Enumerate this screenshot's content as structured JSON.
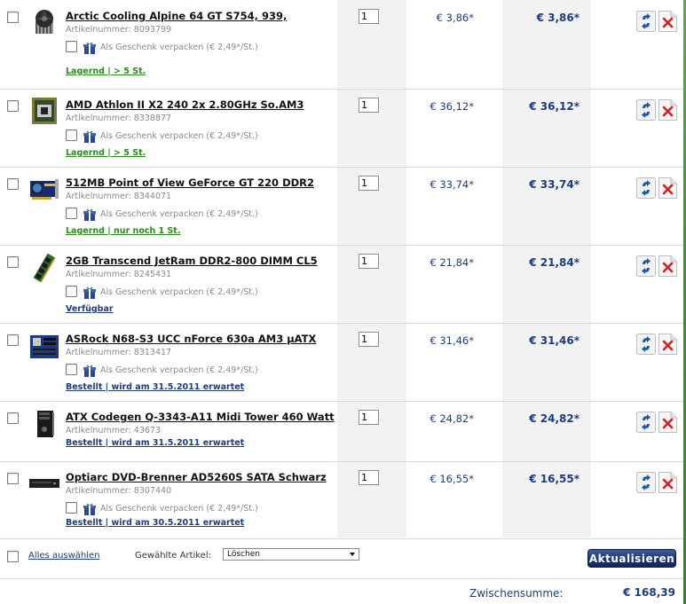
{
  "items": [
    {
      "title": "Arctic Cooling Alpine 64 GT S754, 939,",
      "artnr": "Artikelnummer: 8093799",
      "gift": "Als Geschenk verpacken (€ 2,49*/St.)",
      "status": "Lagernd | > 5 St.",
      "status_color": "#2a8a1c",
      "qty": "1",
      "price": "€ 3,86*",
      "total": "€ 3,86*",
      "thumb": "cpu-cooler-icon"
    },
    {
      "title": "AMD Athlon II X2 240 2x 2.80GHz So.AM3",
      "artnr": "Artikelnummer: 8338877",
      "gift": "Als Geschenk verpacken (€ 2,49*/St.)",
      "status": "Lagernd | > 5 St.",
      "status_color": "#2a8a1c",
      "qty": "1",
      "price": "€ 36,12*",
      "total": "€ 36,12*",
      "thumb": "cpu-icon"
    },
    {
      "title": "512MB Point of View GeForce GT 220 DDR2",
      "artnr": "Artikelnummer: 8344071",
      "gift": "Als Geschenk verpacken (€ 2,49*/St.)",
      "status": "Lagernd | nur noch 1 St.",
      "status_color": "#2a8a1c",
      "qty": "1",
      "price": "€ 33,74*",
      "total": "€ 33,74*",
      "thumb": "graphics-card-icon"
    },
    {
      "title": "2GB Transcend JetRam DDR2-800 DIMM CL5",
      "artnr": "Artikelnummer: 8245431",
      "gift": "Als Geschenk verpacken (€ 2,49*/St.)",
      "status": "Verfügbar",
      "status_color": "#1e3c7a",
      "qty": "1",
      "price": "€ 21,84*",
      "total": "€ 21,84*",
      "thumb": "ram-icon"
    },
    {
      "title": "ASRock N68-S3 UCC nForce 630a AM3 µATX",
      "artnr": "Artikelnummer: 8313417",
      "gift": "Als Geschenk verpacken (€ 2,49*/St.)",
      "status": "Bestellt | wird am 31.5.2011 erwartet",
      "status_color": "#1e3c7a",
      "qty": "1",
      "price": "€ 31,46*",
      "total": "€ 31,46*",
      "thumb": "motherboard-icon"
    },
    {
      "title": "ATX Codegen Q-3343-A11 Midi Tower 460 Watt",
      "artnr": "Artikelnummer: 43673",
      "gift": "",
      "status": "Bestellt | wird am 31.5.2011 erwartet",
      "status_color": "#1e3c7a",
      "qty": "1",
      "price": "€ 24,82*",
      "total": "€ 24,82*",
      "thumb": "pc-tower-icon"
    },
    {
      "title": "Optiarc DVD-Brenner AD5260S SATA Schwarz",
      "artnr": "Artikelnummer: 8307440",
      "gift": "Als Geschenk verpacken (€ 2,49*/St.)",
      "status": "Bestellt | wird am 30.5.2011 erwartet",
      "status_color": "#1e3c7a",
      "qty": "1",
      "price": "€ 16,55*",
      "total": "€ 16,55*",
      "thumb": "dvd-drive-icon"
    }
  ],
  "footer": {
    "select_all": "Alles auswählen",
    "selected_label": "Gewählte Artikel:",
    "action_value": "Löschen",
    "update_label": "Aktualisieren"
  },
  "subtotal": {
    "label": "Zwischensumme:",
    "value": "€ 168,39"
  },
  "colors": {
    "link_blue": "#1e3c7a",
    "stock_green": "#2a8a1c",
    "button_blue": "#1b3270",
    "delete_red": "#d62020"
  }
}
